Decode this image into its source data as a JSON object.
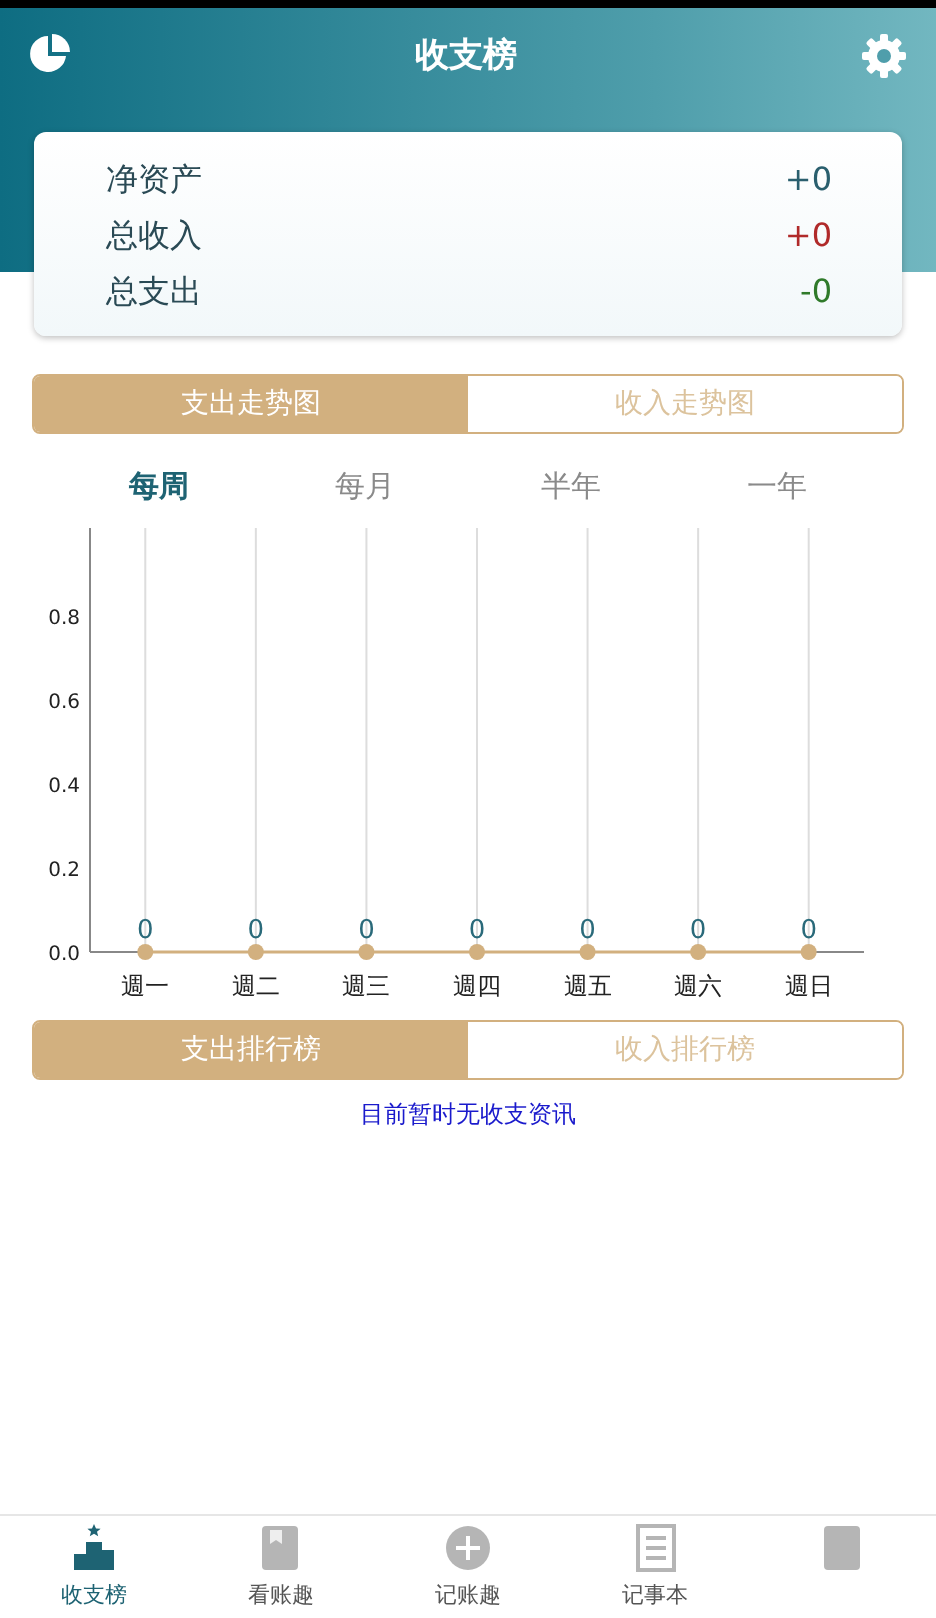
{
  "header": {
    "title": "收支榜"
  },
  "summary": [
    {
      "label": "净资产",
      "value": "+0",
      "color": "#2a5f6e"
    },
    {
      "label": "总收入",
      "value": "+0",
      "color": "#b02a2a"
    },
    {
      "label": "总支出",
      "value": "-0",
      "color": "#2f7a2a"
    }
  ],
  "trend_tabs": [
    {
      "label": "支出走势图",
      "selected": true
    },
    {
      "label": "收入走势图",
      "selected": false
    }
  ],
  "periods": [
    {
      "label": "每周",
      "selected": true
    },
    {
      "label": "每月",
      "selected": false
    },
    {
      "label": "半年",
      "selected": false
    },
    {
      "label": "一年",
      "selected": false
    }
  ],
  "chart_data": {
    "type": "line",
    "categories": [
      "週一",
      "週二",
      "週三",
      "週四",
      "週五",
      "週六",
      "週日"
    ],
    "series": [
      {
        "color": "#d2b07f",
        "marker": true,
        "values": [
          0,
          0,
          0,
          0,
          0,
          0,
          0
        ]
      }
    ],
    "grid": true,
    "ylim": [
      0,
      1
    ],
    "yticks": [
      {
        "value": 0,
        "label": "0.0"
      },
      {
        "value": 0.2,
        "label": "0.2"
      },
      {
        "value": 0.4,
        "label": "0.4"
      },
      {
        "value": 0.6,
        "label": "0.6"
      },
      {
        "value": 0.8,
        "label": "0.8"
      }
    ],
    "data_labels": true
  },
  "rank_tabs": [
    {
      "label": "支出排行榜",
      "selected": true
    },
    {
      "label": "收入排行榜",
      "selected": false
    }
  ],
  "empty_message": "目前暂时无收支资讯",
  "bottom_nav": [
    {
      "kind": "podium",
      "label": "收支榜",
      "selected": true
    },
    {
      "kind": "book",
      "label": "看账趣",
      "selected": false
    },
    {
      "kind": "plus",
      "label": "记账趣",
      "selected": false
    },
    {
      "kind": "notes",
      "label": "记事本",
      "selected": false
    },
    {
      "kind": "square",
      "selected": false
    }
  ]
}
